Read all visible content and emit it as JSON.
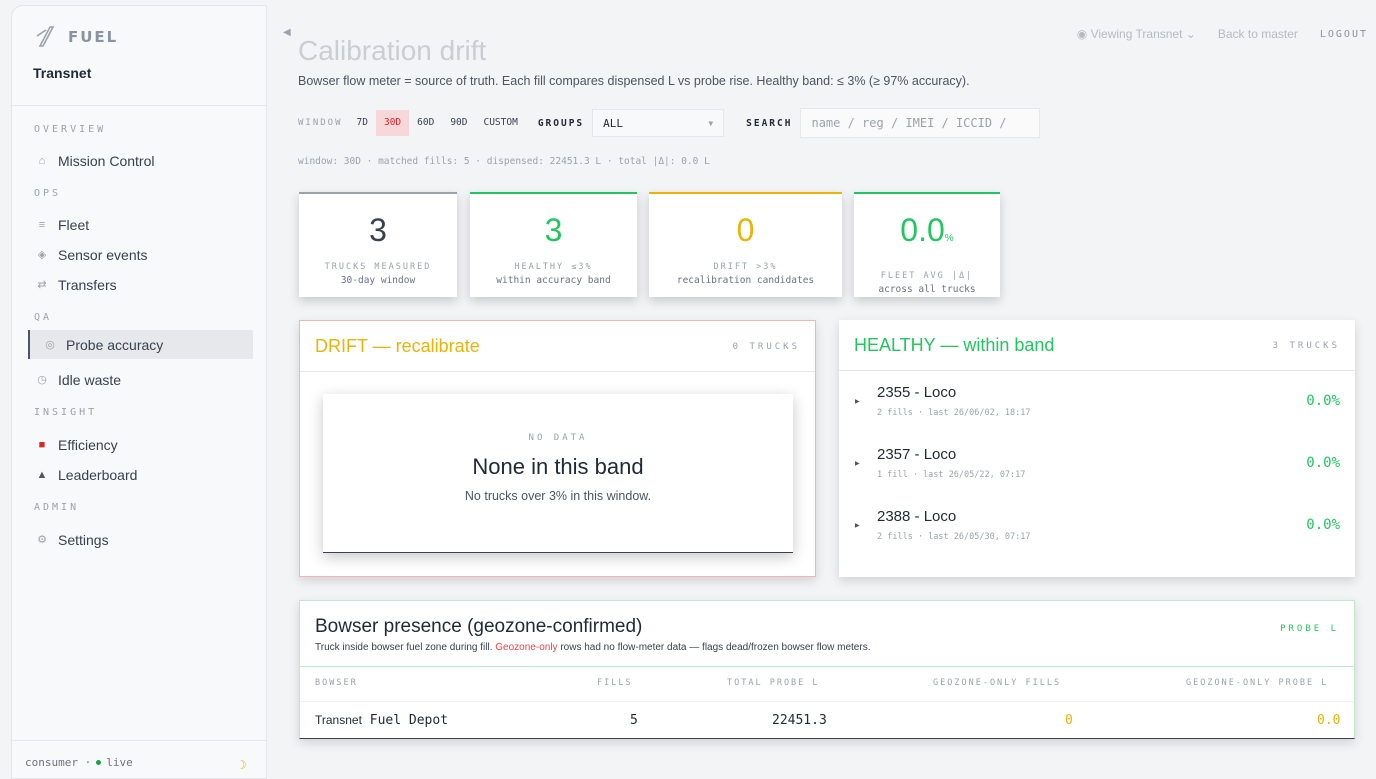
{
  "app": {
    "logo_text": "FUEL",
    "org": "Transnet"
  },
  "sidebar": {
    "sections": [
      {
        "label": "OVERVIEW",
        "items": [
          {
            "label": "Mission Control",
            "icon": "home-icon"
          }
        ]
      },
      {
        "label": "OPS",
        "items": [
          {
            "label": "Fleet",
            "icon": "list-icon"
          },
          {
            "label": "Sensor events",
            "icon": "diamond-icon"
          },
          {
            "label": "Transfers",
            "icon": "swap-icon"
          }
        ]
      },
      {
        "label": "QA",
        "items": [
          {
            "label": "Probe accuracy",
            "icon": "target-icon",
            "active": true
          },
          {
            "label": "Idle waste",
            "icon": "clock-icon"
          }
        ]
      },
      {
        "label": "INSIGHT",
        "items": [
          {
            "label": "Efficiency",
            "icon": "fuel-pump-icon"
          },
          {
            "label": "Leaderboard",
            "icon": "triangle-icon"
          }
        ]
      },
      {
        "label": "ADMIN",
        "items": [
          {
            "label": "Settings",
            "icon": "gear-icon"
          }
        ]
      }
    ],
    "footer": {
      "mode": "consumer ·",
      "status": "live"
    }
  },
  "topbar": {
    "viewing": "Viewing Transnet",
    "back": "Back to master",
    "logout": "LOGOUT"
  },
  "page": {
    "title": "Calibration drift",
    "subtitle": "Bowser flow meter = source of truth. Each fill compares dispensed L vs probe rise. Healthy band: ≤ 3% (≥ 97% accuracy)."
  },
  "filters": {
    "window_label": "WINDOW",
    "windows": [
      "7D",
      "30D",
      "60D",
      "90D",
      "CUSTOM"
    ],
    "active_window": "30D",
    "groups_label": "GROUPS",
    "groups_value": "ALL",
    "search_label": "SEARCH",
    "search_placeholder": "name / reg / IMEI / ICCID /"
  },
  "summary": "window: 30D · matched fills: 5 · dispensed: 22451.3 L · total |Δ|: 0.0 L",
  "stats": [
    {
      "value": "3",
      "label": "TRUCKS MEASURED",
      "sub": "30-day window",
      "color": "#374151",
      "border": "#9aa2ad"
    },
    {
      "value": "3",
      "label": "HEALTHY ≤3%",
      "sub": "within accuracy band",
      "color": "#22c55e",
      "border": "#22c55e"
    },
    {
      "value": "0",
      "label": "DRIFT >3%",
      "sub": "recalibration candidates",
      "color": "#eab308",
      "border": "#eab308"
    },
    {
      "value": "0.0",
      "unit": "%",
      "label": "FLEET AVG |Δ|",
      "sub": "across all trucks",
      "color": "#22c55e",
      "border": "#22c55e"
    }
  ],
  "drift": {
    "title": "DRIFT — recalibrate",
    "count": "0 TRUCKS",
    "empty_label": "NO DATA",
    "empty_title": "None in this band",
    "empty_sub": "No trucks over 3% in this window."
  },
  "healthy": {
    "title": "HEALTHY — within band",
    "count": "3 TRUCKS",
    "trucks": [
      {
        "name": "2355 - Loco",
        "meta": "2 fills · last 26/06/02, 18:17",
        "pct": "0.0%"
      },
      {
        "name": "2357 - Loco",
        "meta": "1 fill · last 26/05/22, 07:17",
        "pct": "0.0%"
      },
      {
        "name": "2388 - Loco",
        "meta": "2 fills · last 26/05/30, 07:17",
        "pct": "0.0%"
      }
    ]
  },
  "bowser": {
    "title": "Bowser presence (geozone-confirmed)",
    "unit_label": "PROBE L",
    "desc_pre": "Truck inside bowser fuel zone during fill. ",
    "desc_red": "Geozone-only",
    "desc_post": " rows had no flow-meter data — flags dead/frozen bowser flow meters.",
    "headers": {
      "bowser": "BOWSER",
      "fills": "FILLS",
      "total": "TOTAL PROBE L",
      "geo_fills": "GEOZONE-ONLY FILLS",
      "geo_probe": "GEOZONE-ONLY PROBE L"
    },
    "row": {
      "org": "Transnet",
      "depot": "Fuel Depot",
      "fills": "5",
      "total": "22451.3",
      "geo_fills": "0",
      "geo_probe": "0.0"
    }
  },
  "colors": {
    "accent_red": "#dc2626",
    "healthy": "#22c55e",
    "drift": "#eab308"
  }
}
